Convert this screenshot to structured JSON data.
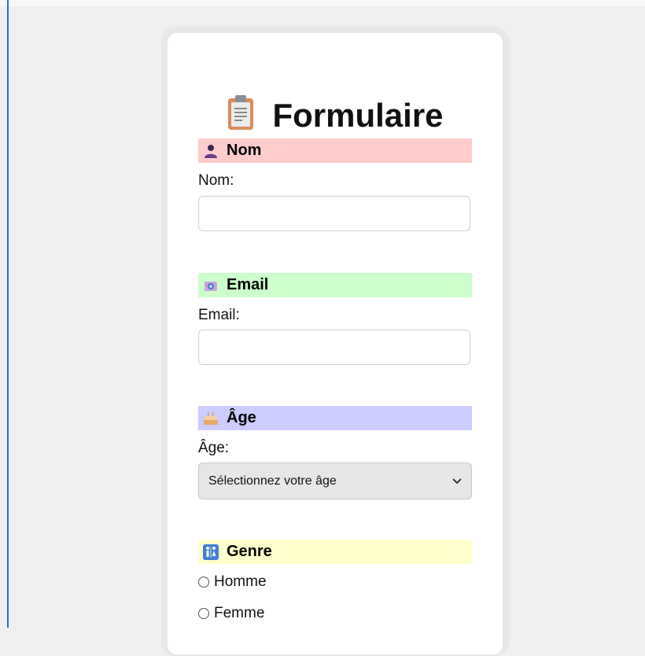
{
  "form": {
    "title": "Formulaire",
    "sections": {
      "nom": {
        "header": "Nom",
        "label": "Nom:",
        "value": "",
        "color": "#ffcccc",
        "icon": "user-silhouette-icon"
      },
      "email": {
        "header": "Email",
        "label": "Email:",
        "value": "",
        "color": "#ccffcc",
        "icon": "email-icon"
      },
      "age": {
        "header": "Âge",
        "label": "Âge:",
        "selected": "Sélectionnez votre âge",
        "color": "#ccccff",
        "icon": "cake-icon"
      },
      "genre": {
        "header": "Genre",
        "color": "#ffffcc",
        "icon": "restroom-icon",
        "options": [
          "Homme",
          "Femme"
        ]
      }
    }
  },
  "colors": {
    "background": "#efefef",
    "card": "#ffffff",
    "accent_rule": "#1f6fd1"
  }
}
